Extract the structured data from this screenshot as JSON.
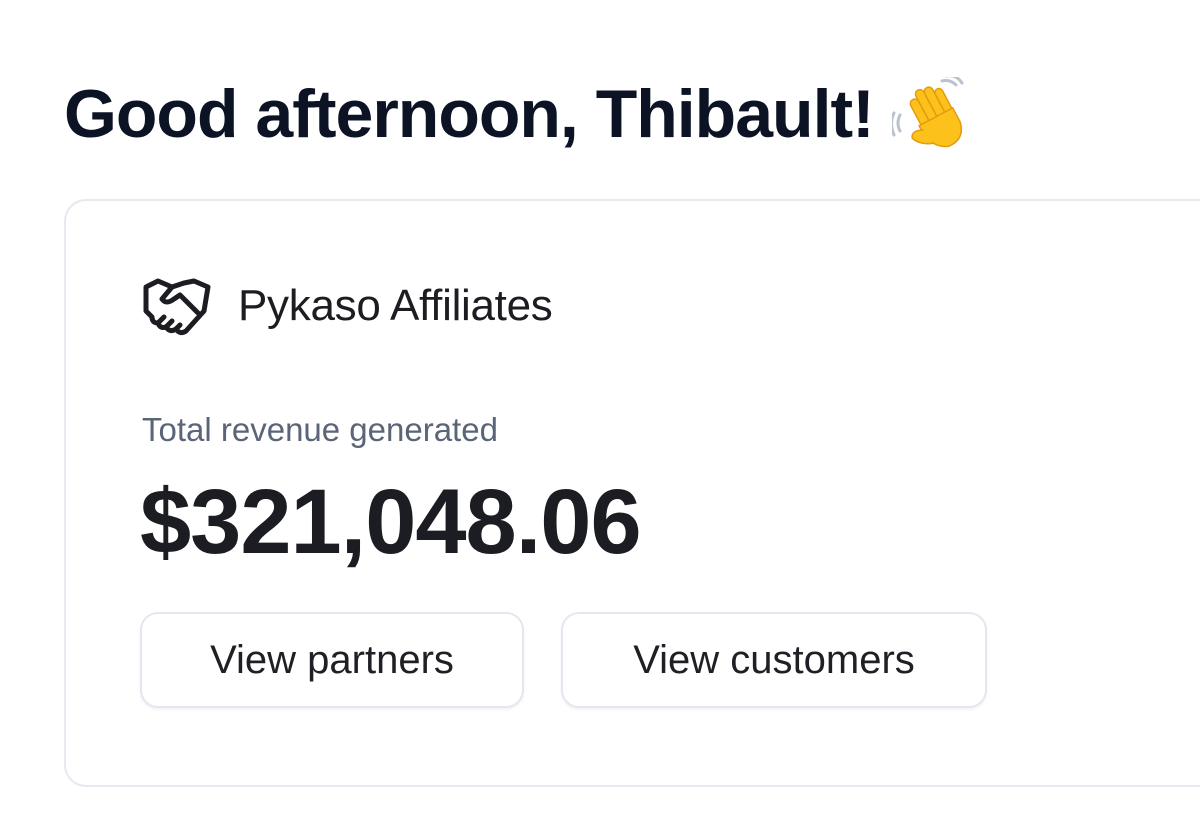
{
  "greeting": {
    "text": "Good afternoon, Thibault!",
    "emoji_icon": "waving-hand-icon"
  },
  "card": {
    "icon": "handshake-icon",
    "title": "Pykaso Affiliates",
    "metric_label": "Total revenue generated",
    "metric_value": "$321,048.06",
    "buttons": {
      "partners_label": "View partners",
      "customers_label": "View customers"
    }
  },
  "colors": {
    "heading": "#0c1324",
    "text": "#1c1d22",
    "muted": "#5b6578",
    "border": "#e3e8f0",
    "emoji": "#fcc419"
  }
}
